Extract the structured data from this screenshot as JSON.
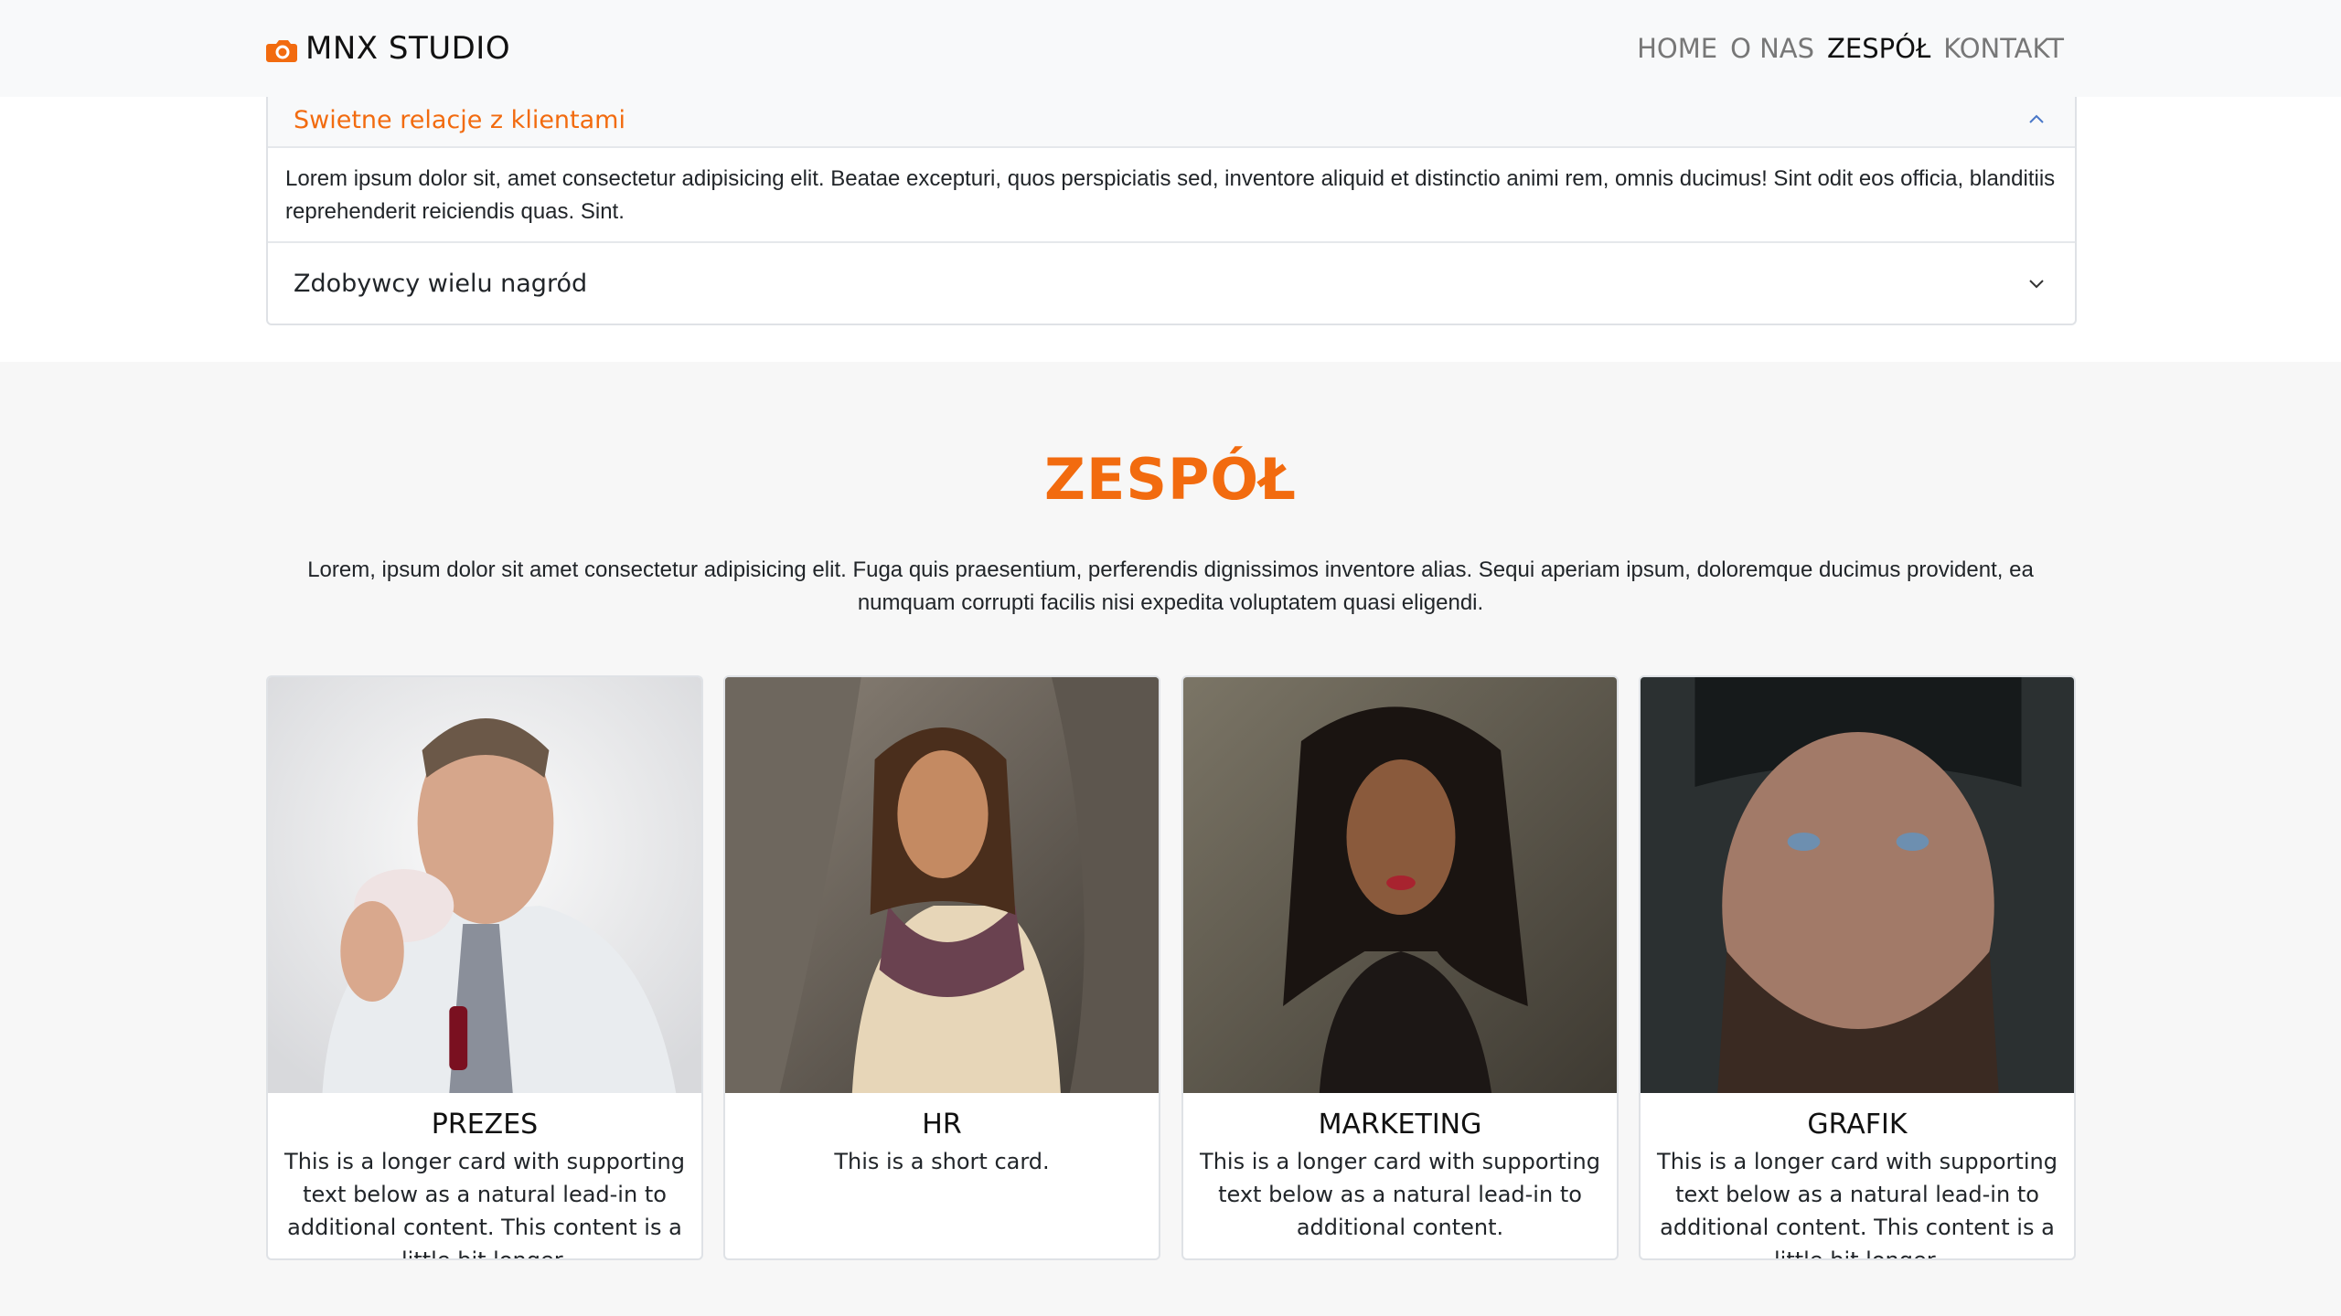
{
  "navbar": {
    "brand": "MNX STUDIO",
    "brand_icon": "camera-icon",
    "links": [
      {
        "label": "HOME",
        "active": false
      },
      {
        "label": "O NAS",
        "active": false
      },
      {
        "label": "ZESPÓŁ",
        "active": true
      },
      {
        "label": "KONTAKT",
        "active": false
      }
    ]
  },
  "accordion": {
    "items": [
      {
        "title": "Swietne relacje z klientami",
        "expanded": true,
        "body": "Lorem ipsum dolor sit, amet consectetur adipisicing elit. Beatae excepturi, quos perspiciatis sed, inventore aliquid et distinctio animi rem, omnis ducimus! Sint odit eos officia, blanditiis reprehenderit reiciendis quas. Sint."
      },
      {
        "title": "Zdobywcy wielu nagród",
        "expanded": false
      }
    ]
  },
  "team": {
    "title": "ZESPÓŁ",
    "lead": "Lorem, ipsum dolor sit amet consectetur adipisicing elit. Fuga quis praesentium, perferendis dignissimos inventore alias. Sequi aperiam ipsum, doloremque ducimus provident, ea numquam corrupti facilis nisi expedita voluptatem quasi eligendi.",
    "cards": [
      {
        "title": "PREZES",
        "text": "This is a longer card with supporting text below as a natural lead-in to additional content. This content is a little bit longer."
      },
      {
        "title": "HR",
        "text": "This is a short card."
      },
      {
        "title": "MARKETING",
        "text": "This is a longer card with supporting text below as a natural lead-in to additional content."
      },
      {
        "title": "GRAFIK",
        "text": "This is a longer card with supporting text below as a natural lead-in to additional content. This content is a little bit longer."
      }
    ]
  },
  "colors": {
    "accent": "#f26b0f",
    "navbar_bg": "#f8f9fa",
    "section_bg": "#f7f7f7"
  }
}
